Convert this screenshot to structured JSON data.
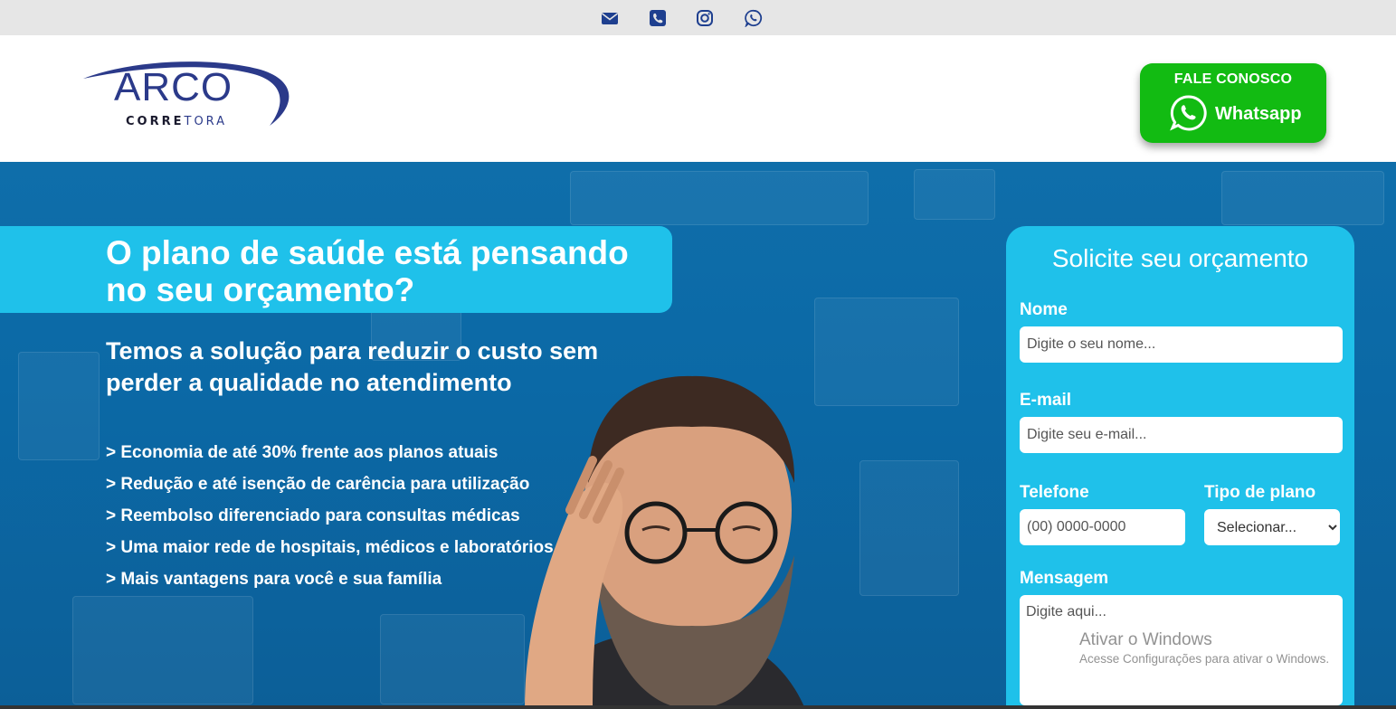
{
  "topbar": {
    "icons": [
      "email-icon",
      "phone-icon",
      "instagram-icon",
      "whatsapp-icon"
    ]
  },
  "header": {
    "logo_main": "ARCO",
    "logo_sub_bold": "CORRE",
    "logo_sub_light": "TORA",
    "cta_top": "FALE CONOSCO",
    "cta_label": "Whatsapp"
  },
  "hero": {
    "headline": "O plano de saúde está pensando no seu orçamento?",
    "subheadline": "Temos a solução para reduzir o custo sem perder a qualidade no atendimento",
    "benefits": [
      "> Economia de até 30% frente aos planos atuais",
      "> Redução e até isenção de carência para utilização",
      "> Reembolso diferenciado para consultas médicas",
      "> Uma maior rede de hospitais, médicos e laboratórios",
      "> Mais vantagens para você e sua família"
    ]
  },
  "form": {
    "title": "Solicite seu orçamento",
    "name_label": "Nome",
    "name_placeholder": "Digite o seu nome...",
    "email_label": "E-mail",
    "email_placeholder": "Digite seu e-mail...",
    "phone_label": "Telefone",
    "phone_placeholder": "(00) 0000-0000",
    "plan_label": "Tipo de plano",
    "plan_selected": "Selecionar...",
    "message_label": "Mensagem",
    "message_placeholder": "Digite aqui..."
  },
  "watermark": {
    "line1": "Ativar o Windows",
    "line2": "Acesse Configurações para ativar o Windows."
  },
  "colors": {
    "brand_blue": "#2b3a8a",
    "hero_blue": "#0b69a6",
    "accent_cyan": "#1fc1ea",
    "whatsapp_green": "#12bb12",
    "topbar_icon": "#1e3f8f"
  }
}
